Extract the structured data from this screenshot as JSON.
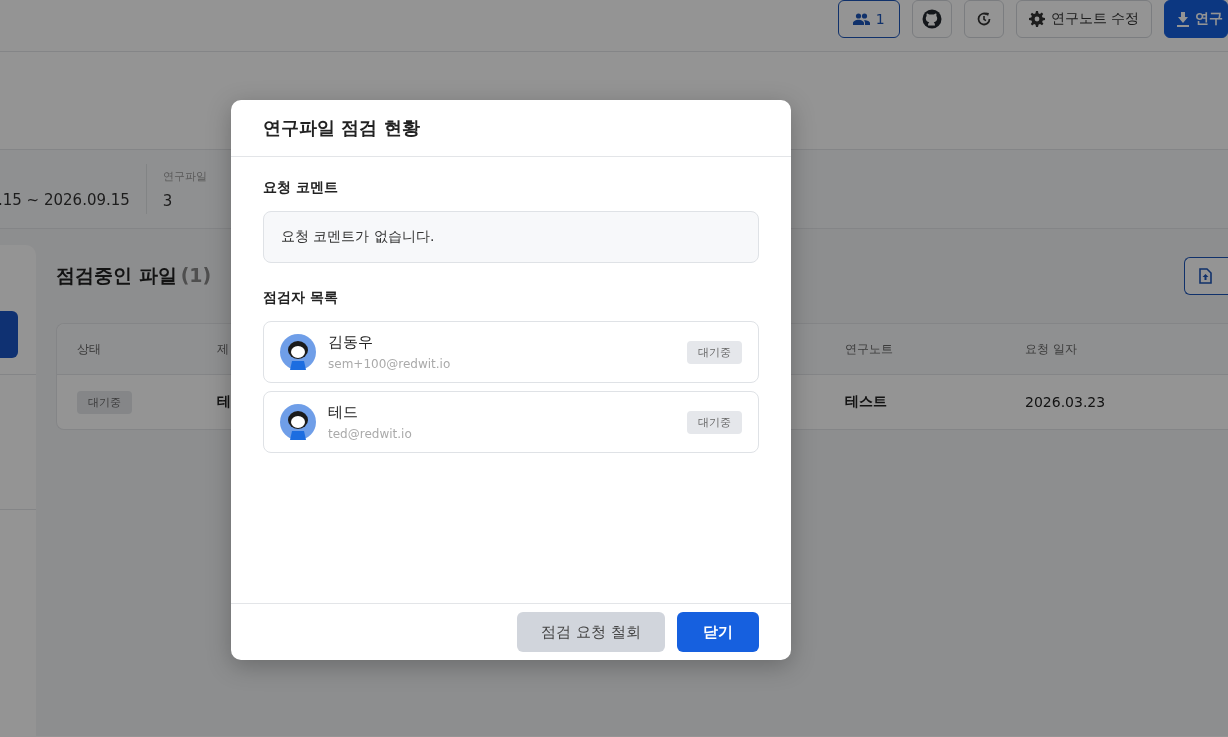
{
  "header": {
    "buttons": [
      {
        "kind": "members",
        "label": "1"
      },
      {
        "kind": "github"
      },
      {
        "kind": "history"
      },
      {
        "kind": "settings",
        "label": "연구노트 수정"
      },
      {
        "kind": "download",
        "label": "연구"
      }
    ]
  },
  "info": {
    "period": ".15 ~ 2026.09.15",
    "files_label": "연구파일",
    "files_value": "3"
  },
  "section": {
    "title": "점검중인 파일",
    "count": "(1)"
  },
  "table": {
    "columns": [
      "상태",
      "제",
      "연구노트",
      "요청 일자"
    ],
    "rows": [
      {
        "status": "대기중",
        "title": "테",
        "note": "테스트",
        "date": "2026.03.23"
      }
    ]
  },
  "modal": {
    "title": "연구파일 점검 현황",
    "comment_label": "요청 코멘트",
    "comment": "요청 코멘트가 없습니다.",
    "reviewers_label": "점검자 목록",
    "reviewers": [
      {
        "name": "김동우",
        "email": "sem+100@redwit.io",
        "status": "대기중"
      },
      {
        "name": "테드",
        "email": "ted@redwit.io",
        "status": "대기중"
      }
    ],
    "buttons": [
      {
        "kind": "secondary",
        "label": "점검 요청 철회"
      },
      {
        "kind": "primary",
        "label": "닫기"
      }
    ]
  }
}
